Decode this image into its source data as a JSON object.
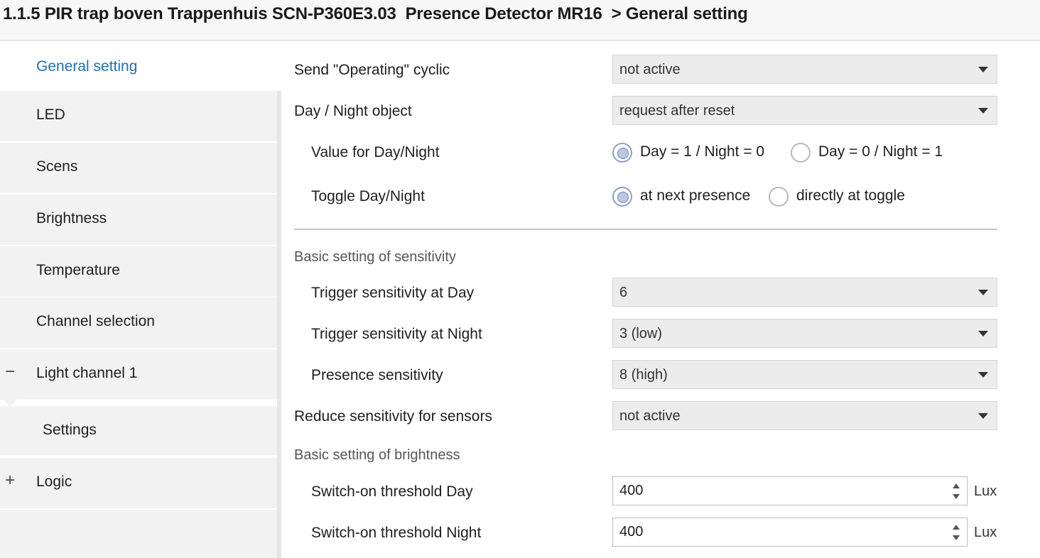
{
  "title": "1.1.5 PIR trap boven Trappenhuis SCN-P360E3.03  Presence Detector MR16  > General setting",
  "sidebar": {
    "items": [
      {
        "label": "General setting",
        "active": true
      },
      {
        "label": "LED"
      },
      {
        "label": "Scens"
      },
      {
        "label": "Brightness"
      },
      {
        "label": "Temperature"
      },
      {
        "label": "Channel selection"
      },
      {
        "label": "Light channel 1",
        "expander": "−"
      },
      {
        "label": "Settings"
      },
      {
        "label": "Logic",
        "expander": "+"
      }
    ]
  },
  "params": {
    "send_operating": {
      "label": "Send \"Operating\" cyclic",
      "value": "not active"
    },
    "day_night_object": {
      "label": "Day / Night object",
      "value": "request after reset"
    },
    "value_day_night": {
      "label": "Value for Day/Night",
      "options": [
        "Day = 1 / Night = 0",
        "Day = 0 / Night = 1"
      ],
      "selected": 0
    },
    "toggle_day_night": {
      "label": "Toggle Day/Night",
      "options": [
        "at next presence",
        "directly at toggle"
      ],
      "selected": 0
    },
    "section_sensitivity": "Basic setting of sensitivity",
    "trigger_day": {
      "label": "Trigger sensitivity at Day",
      "value": "6"
    },
    "trigger_night": {
      "label": "Trigger sensitivity at Night",
      "value": "3 (low)"
    },
    "presence_sensitivity": {
      "label": "Presence sensitivity",
      "value": "8 (high)"
    },
    "reduce_sensitivity": {
      "label": "Reduce sensitivity for sensors",
      "value": "not active"
    },
    "section_brightness": "Basic setting of brightness",
    "threshold_day": {
      "label": "Switch-on threshold Day",
      "value": "400",
      "unit": "Lux"
    },
    "threshold_night": {
      "label": "Switch-on threshold Night",
      "value": "400",
      "unit": "Lux"
    }
  },
  "colors": {
    "active_nav": "#1f6fb5",
    "sidebar_bg": "#f2f2f2",
    "select_bg": "#ececec",
    "radio_checked": "#b9c7e0"
  }
}
